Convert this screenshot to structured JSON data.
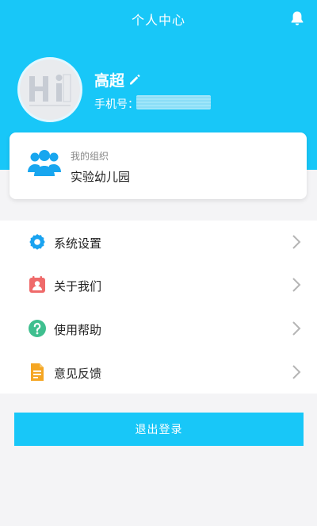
{
  "colors": {
    "accent": "#18c7f8",
    "background": "#f4f4f6",
    "card": "#ffffff",
    "settings_icon": "#1aa3f0",
    "about_icon": "#ef6a6a",
    "help_icon": "#3fbf8f",
    "feedback_icon": "#f5a623"
  },
  "header": {
    "title": "个人中心",
    "bell_icon": "bell-icon"
  },
  "profile": {
    "avatar_text": "Hi",
    "name": "高超",
    "phone_label": "手机号：",
    "phone_value": "",
    "edit_icon": "pencil-icon"
  },
  "organization": {
    "label": "我的组织",
    "name": "实验幼儿园",
    "icon": "people-group-icon"
  },
  "menu": {
    "items": [
      {
        "label": "系统设置",
        "icon": "gear-icon"
      },
      {
        "label": "关于我们",
        "icon": "contact-card-icon"
      },
      {
        "label": "使用帮助",
        "icon": "question-circle-icon"
      },
      {
        "label": "意见反馈",
        "icon": "document-icon"
      }
    ]
  },
  "logout": {
    "label": "退出登录"
  }
}
